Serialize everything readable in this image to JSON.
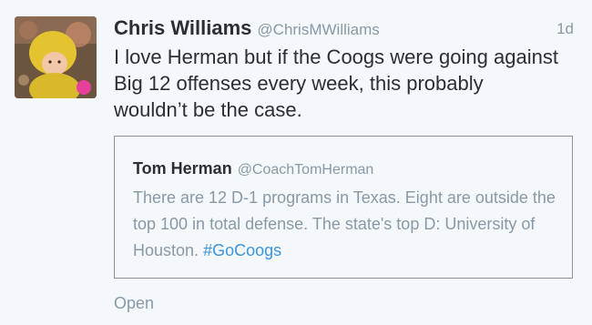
{
  "tweet": {
    "author_name": "Chris Williams",
    "author_handle": "@ChrisMWilliams",
    "timestamp": "1d",
    "text": "I love Herman but if the Coogs were going against Big 12 offenses every week, this probably wouldn’t be the case."
  },
  "quoted_tweet": {
    "author_name": "Tom Herman",
    "author_handle": "@CoachTomHerman",
    "text": "There are 12 D-1 programs in Texas. Eight are outside the top 100 in total defense. The state's top D: University of Houston.",
    "hashtag": "#GoCoogs"
  },
  "actions": {
    "open_label": "Open"
  },
  "colors": {
    "background": "#f5f8fa",
    "name": "#292f33",
    "muted": "#8899a6",
    "link": "#3b94d9",
    "quote_border": "#8b939a"
  }
}
